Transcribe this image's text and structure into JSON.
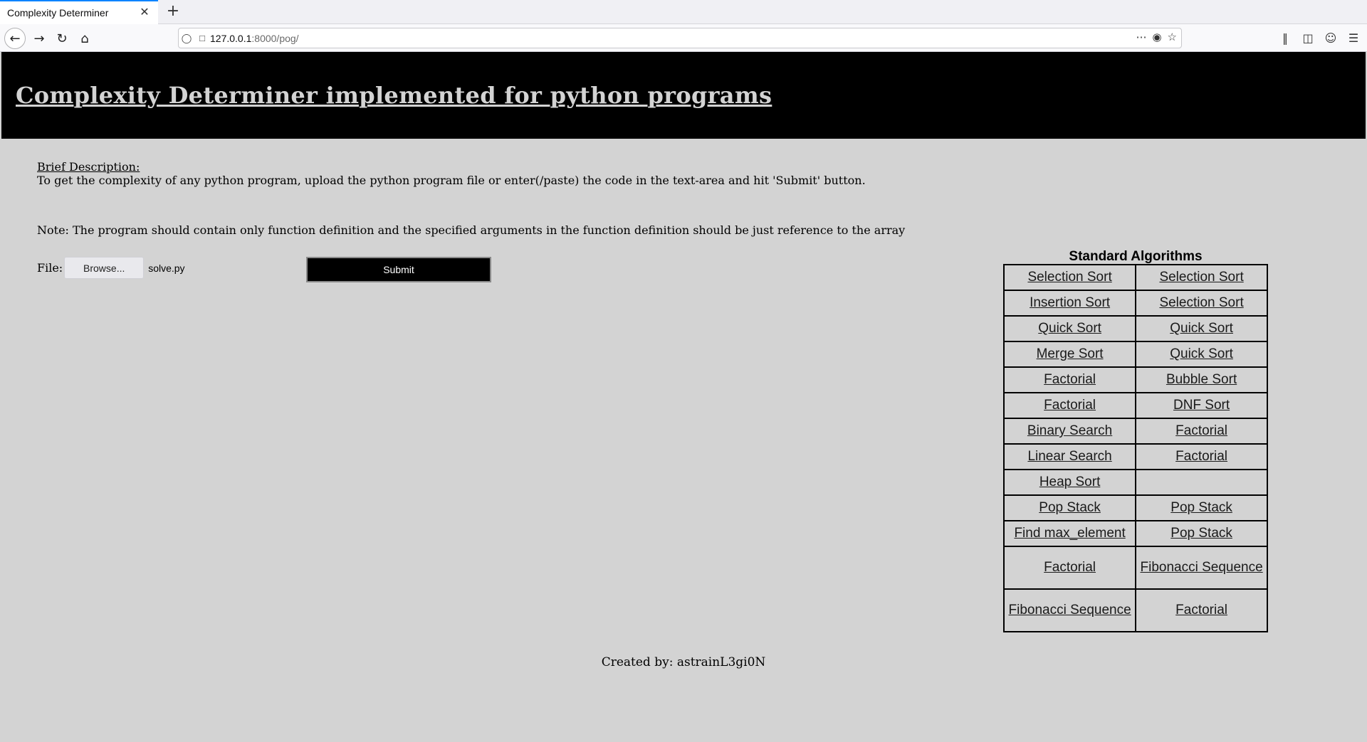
{
  "browser": {
    "tab_title": "Complexity Determiner",
    "tab_close": "✕",
    "new_tab": "+",
    "url_host": "127.0.0.1",
    "url_path": ":8000/pog/"
  },
  "header": {
    "title": "Complexity Determiner implemented for python programs"
  },
  "description": {
    "heading": "Brief Description:",
    "text": "To get the complexity of any python program, upload the python program file or enter(/paste) the code in the text-area and hit 'Submit' button.",
    "note": "Note: The program should contain only function definition and the specified arguments in the function definition should be just reference to the array"
  },
  "form": {
    "file_label": "File:",
    "browse_label": "Browse...",
    "file_name": "solve.py",
    "submit_label": "Submit"
  },
  "algorithms": {
    "caption": "Standard Algorithms",
    "rows": [
      [
        "Selection Sort",
        "Selection Sort"
      ],
      [
        "Insertion Sort",
        "Selection Sort"
      ],
      [
        "Quick Sort",
        "Quick Sort"
      ],
      [
        "Merge Sort",
        "Quick Sort"
      ],
      [
        "Factorial",
        "Bubble Sort"
      ],
      [
        "Factorial",
        "DNF Sort"
      ],
      [
        "Binary Search",
        "Factorial"
      ],
      [
        "Linear Search",
        "Factorial"
      ],
      [
        "Heap Sort",
        ""
      ],
      [
        "Pop Stack",
        "Pop Stack"
      ],
      [
        "Find max_element",
        "Pop Stack"
      ],
      [
        "Factorial",
        "Fibonacci Sequence"
      ],
      [
        "Fibonacci Sequence",
        "Factorial"
      ]
    ]
  },
  "footer": {
    "text": "Created by: astrainL3gi0N"
  }
}
